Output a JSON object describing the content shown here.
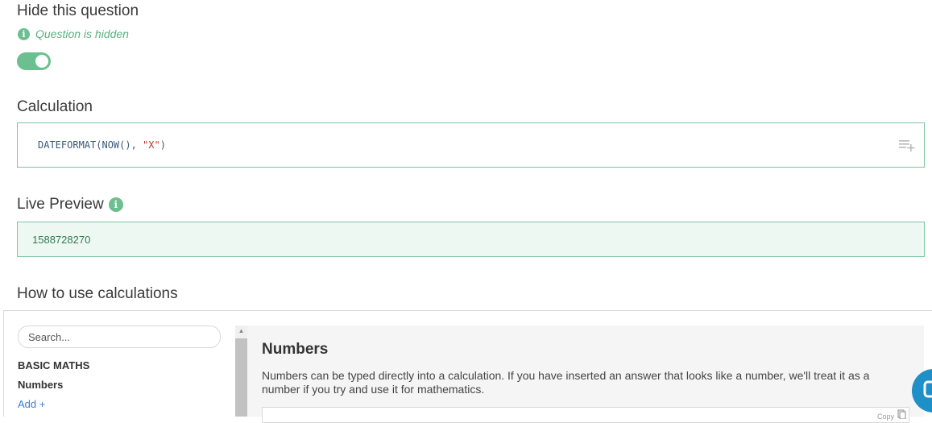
{
  "hide_section": {
    "title": "Hide this question",
    "status_text": "Question is hidden",
    "toggle_on": true
  },
  "calculation": {
    "title": "Calculation",
    "code_func": "DATEFORMAT(NOW(), ",
    "code_string": "\"X\"",
    "code_close": ")",
    "insert_icon": "insert-field-icon"
  },
  "live_preview": {
    "title": "Live Preview",
    "value": "1588728270"
  },
  "howto": {
    "title": "How to use calculations",
    "search_placeholder": "Search...",
    "category": "BASIC MATHS",
    "items": [
      "Numbers",
      "Add +"
    ],
    "content_title": "Numbers",
    "content_text": "Numbers can be typed directly into a calculation. If you have inserted an answer that looks like a number, we'll treat it as a number if you try and use it for mathematics.",
    "copy_label": "Copy"
  },
  "colors": {
    "accent_green": "#6cbf8f",
    "preview_bg": "#eef8f2",
    "link_blue": "#3a7bd5",
    "chat_blue": "#1f8fc8"
  }
}
